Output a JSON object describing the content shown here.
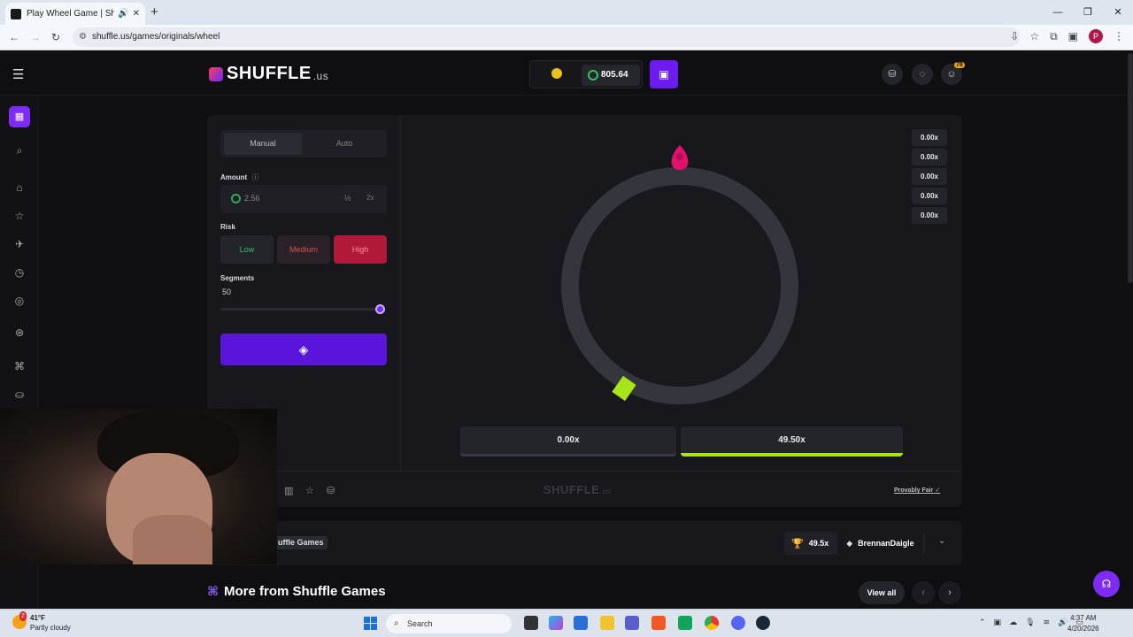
{
  "browser": {
    "tab_title": "Play Wheel Game | Shuffle.us",
    "url": "shuffle.us/games/originals/wheel",
    "profile_initial": "P"
  },
  "header": {
    "logo_text": "SHUFFLE",
    "logo_suffix": ".us",
    "balance": "805.64",
    "notification_count": "78"
  },
  "controls": {
    "mode_manual": "Manual",
    "mode_auto": "Auto",
    "amount_label": "Amount",
    "amount_value": "2.56",
    "half_label": "½",
    "double_label": "2x",
    "risk_label": "Risk",
    "risk_low": "Low",
    "risk_medium": "Medium",
    "risk_high": "High",
    "risk_selected": "High",
    "segments_label": "Segments",
    "segments_value": "50"
  },
  "wheel": {
    "history": [
      "0.00x",
      "0.00x",
      "0.00x",
      "0.00x",
      "0.00x"
    ],
    "segment_values": [
      "0.00x",
      "49.50x"
    ]
  },
  "game_footer": {
    "logo_text": "SHUFFLE",
    "logo_suffix": ".us",
    "provably_fair": "Provably Fair"
  },
  "info": {
    "breadcrumb": "uffle Games",
    "top_multiplier": "49.5x",
    "top_player": "BrennanDaigle"
  },
  "more": {
    "title": "More from Shuffle Games",
    "view_all": "View all"
  },
  "taskbar": {
    "temperature": "41°F",
    "weather": "Partly cloudy",
    "weather_badge": "2",
    "search_label": "Search",
    "time": "4:37 AM",
    "date": "4/20/2026"
  },
  "colors": {
    "accent": "#6d1cf0",
    "risk_high": "#b1193a",
    "win_segment": "#a7e51b",
    "pointer": "#e0126b"
  }
}
